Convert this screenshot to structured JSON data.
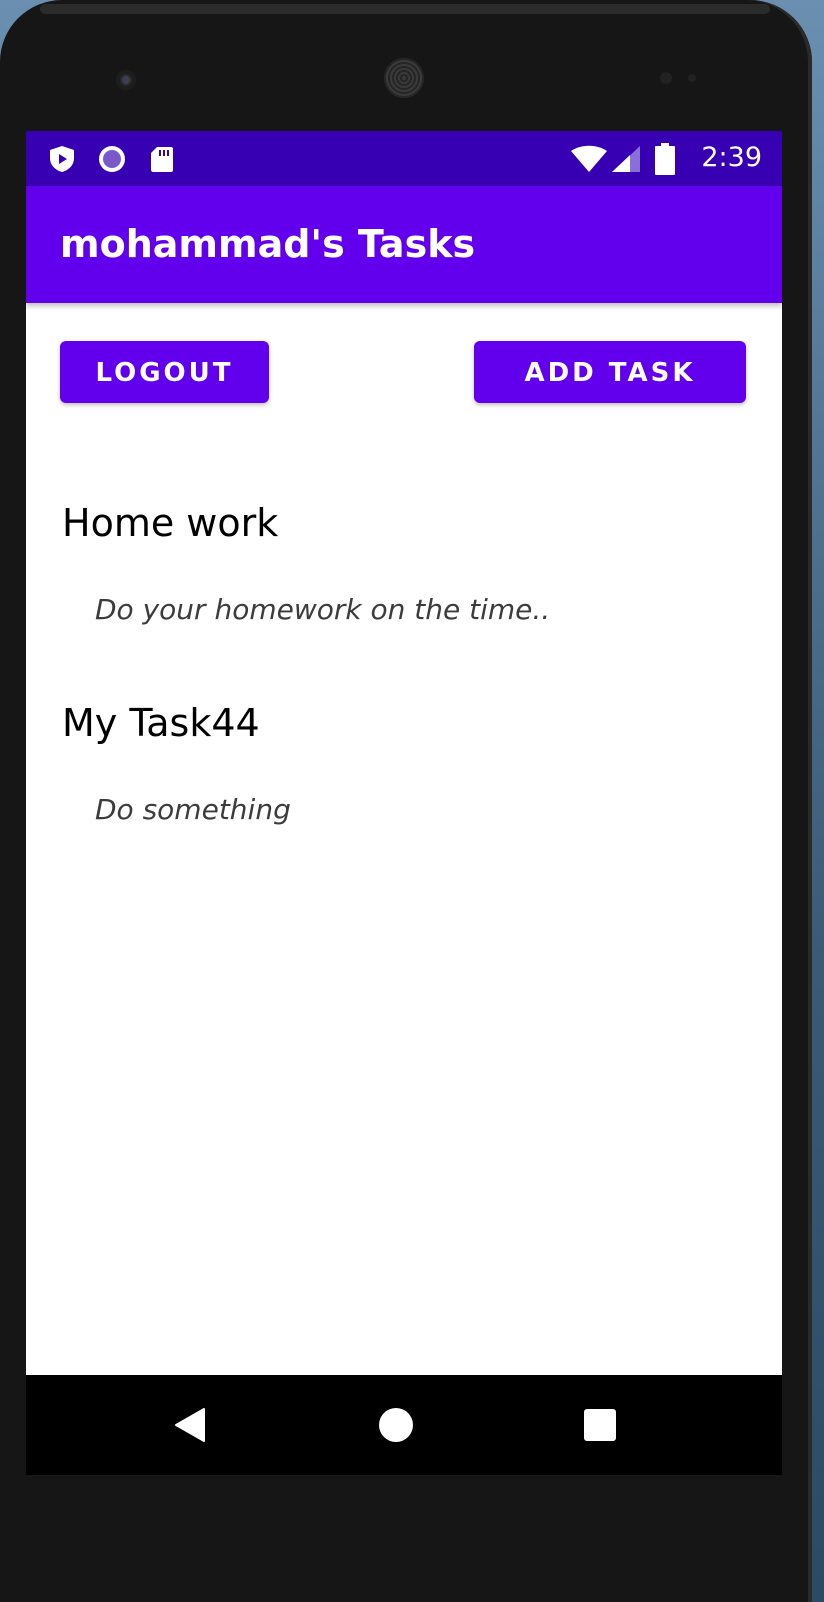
{
  "status_bar": {
    "time": "2:39",
    "left_icons": [
      "play-protect-icon",
      "record-circle-icon",
      "sd-card-icon"
    ],
    "right_icons": [
      "wifi-icon",
      "cell-signal-icon",
      "battery-icon"
    ]
  },
  "app_bar": {
    "title": "mohammad's Tasks",
    "color": "#6200ee"
  },
  "actions": {
    "logout_label": "LOGOUT",
    "add_task_label": "ADD TASK"
  },
  "tasks": [
    {
      "title": "Home work",
      "description": "Do your homework on the time.."
    },
    {
      "title": "My Task44",
      "description": "Do something"
    }
  ],
  "nav_bar": {
    "buttons": [
      "back-icon",
      "home-icon",
      "recents-icon"
    ]
  },
  "colors": {
    "primary": "#6200ee",
    "primary_dark": "#3700b3"
  }
}
